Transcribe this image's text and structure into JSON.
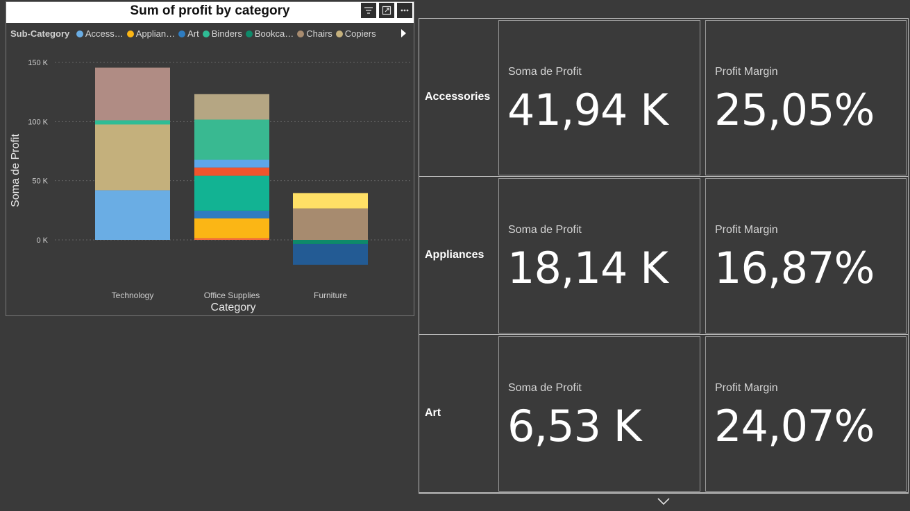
{
  "chart": {
    "title": "Sum of profit by category",
    "legend_title": "Sub-Category",
    "legend_items": [
      {
        "label": "Access…",
        "color": "#6aade4"
      },
      {
        "label": "Applian…",
        "color": "#fbb615"
      },
      {
        "label": "Art",
        "color": "#2e7cc0"
      },
      {
        "label": "Binders",
        "color": "#2fbc95"
      },
      {
        "label": "Bookca…",
        "color": "#0e8a6a"
      },
      {
        "label": "Chairs",
        "color": "#a78b6f"
      },
      {
        "label": "Copiers",
        "color": "#c4b07c"
      }
    ],
    "icons": [
      "filter-icon",
      "focus-mode-icon",
      "more-options-icon"
    ]
  },
  "chart_data": {
    "type": "bar",
    "stacked": true,
    "title": "Sum of profit by category",
    "xlabel": "Category",
    "ylabel": "Soma de Profit",
    "categories": [
      "Technology",
      "Office Supplies",
      "Furniture"
    ],
    "yticks": [
      "150 K",
      "100 K",
      "50 K",
      "0 K"
    ],
    "ytick_values": [
      150000,
      100000,
      50000,
      0
    ],
    "ylim": [
      -25000,
      155000
    ],
    "grid": true,
    "legend_position": "top",
    "segments": [
      {
        "category": "Technology",
        "color": "#6aade4",
        "value": 41940
      },
      {
        "category": "Technology",
        "color": "#c4b07c",
        "value": 55620
      },
      {
        "category": "Technology",
        "color": "#2fbc95",
        "value": 3500
      },
      {
        "category": "Technology",
        "color": "#b08c84",
        "value": 44510
      },
      {
        "category": "Office Supplies",
        "color": "#f56d3b",
        "value": 1500
      },
      {
        "category": "Office Supplies",
        "color": "#fbb615",
        "value": 16640
      },
      {
        "category": "Office Supplies",
        "color": "#2e7cc0",
        "value": 6530
      },
      {
        "category": "Office Supplies",
        "color": "#12b393",
        "value": 29500
      },
      {
        "category": "Office Supplies",
        "color": "#f0552d",
        "value": 7000
      },
      {
        "category": "Office Supplies",
        "color": "#5ea6ea",
        "value": 6500
      },
      {
        "category": "Office Supplies",
        "color": "#39b991",
        "value": 34000
      },
      {
        "category": "Office Supplies",
        "color": "#b5a683",
        "value": 21500
      },
      {
        "category": "Furniture",
        "color": "#a78b6f",
        "value": 26600
      },
      {
        "category": "Furniture",
        "color": "#ffe066",
        "value": 13000
      },
      {
        "category": "Furniture",
        "color": "#0e8a6a",
        "value": -3500
      },
      {
        "category": "Furniture",
        "color": "#235b94",
        "value": -17500
      }
    ]
  },
  "cards": {
    "rows": [
      {
        "label": "Accessories",
        "metric1_label": "Soma de Profit",
        "metric1_value": "41,94 K",
        "metric2_label": "Profit Margin",
        "metric2_value": "25,05%"
      },
      {
        "label": "Appliances",
        "metric1_label": "Soma de Profit",
        "metric1_value": "18,14 K",
        "metric2_label": "Profit Margin",
        "metric2_value": "16,87%"
      },
      {
        "label": "Art",
        "metric1_label": "Soma de Profit",
        "metric1_value": "6,53 K",
        "metric2_label": "Profit Margin",
        "metric2_value": "24,07%"
      }
    ],
    "scroll_icon": "chevron-down-icon"
  }
}
